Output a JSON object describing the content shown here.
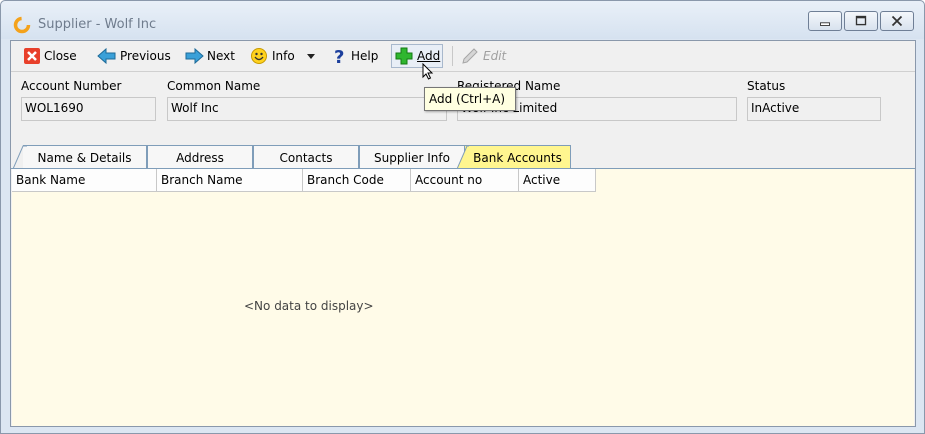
{
  "window": {
    "title": "Supplier - Wolf Inc",
    "minimize_icon": "minimize-icon",
    "maximize_icon": "maximize-icon",
    "close_icon": "close-icon"
  },
  "toolbar": {
    "close_label": "Close",
    "previous_label": "Previous",
    "next_label": "Next",
    "info_label": "Info",
    "help_label": "Help",
    "add_label": "Add",
    "edit_label": "Edit",
    "add_tooltip": "Add (Ctrl+A)"
  },
  "fields": {
    "account_number": {
      "label": "Account Number",
      "value": "WOL1690"
    },
    "common_name": {
      "label": "Common Name",
      "value": "Wolf Inc"
    },
    "registered_name": {
      "label": "Registered Name",
      "value": "Wolf Inc Limited"
    },
    "status": {
      "label": "Status",
      "value": "InActive"
    }
  },
  "tabs": [
    {
      "label": "Name & Details",
      "active": false
    },
    {
      "label": "Address",
      "active": false
    },
    {
      "label": "Contacts",
      "active": false
    },
    {
      "label": "Supplier Info",
      "active": false
    },
    {
      "label": "Bank Accounts",
      "active": true
    }
  ],
  "grid": {
    "columns": [
      "Bank Name",
      "Branch Name",
      "Branch Code",
      "Account no",
      "Active"
    ],
    "empty_text": "<No data to display>"
  },
  "colors": {
    "active_tab": "#fff68f",
    "grid_background": "#fffbe8",
    "tooltip_background": "#ffffe1"
  }
}
